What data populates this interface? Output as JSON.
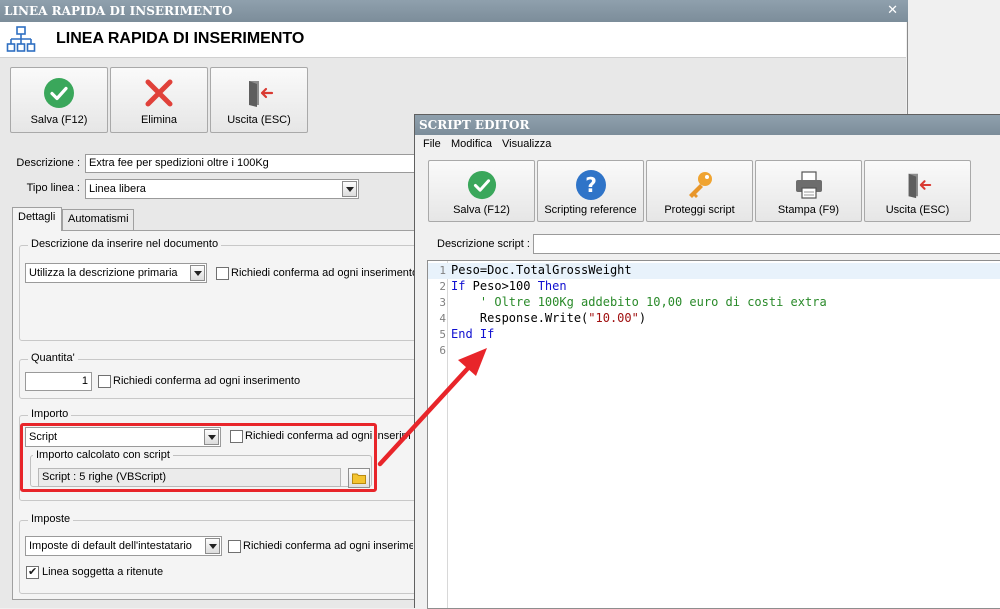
{
  "main_window": {
    "titlebar": "LINEA RAPIDA DI INSERIMENTO",
    "header_title": "LINEA RAPIDA DI INSERIMENTO",
    "toolbar": {
      "save_label": "Salva (F12)",
      "delete_label": "Elimina",
      "exit_label": "Uscita (ESC)"
    },
    "descrizione": {
      "label": "Descrizione :",
      "value": "Extra fee per spedizioni oltre i 100Kg"
    },
    "tipo_linea": {
      "label": "Tipo linea :",
      "value": "Linea libera"
    },
    "tabs": [
      {
        "label": "Dettagli"
      },
      {
        "label": "Automatismi"
      }
    ],
    "group_descrizione": {
      "title": "Descrizione da inserire nel documento",
      "select_value": "Utilizza la descrizione primaria",
      "confirm_label": "Richiedi conferma ad ogni inserimento"
    },
    "group_quantita": {
      "title": "Quantita'",
      "value": "1",
      "confirm_label": "Richiedi conferma ad ogni inserimento"
    },
    "group_importo": {
      "title": "Importo",
      "select_value": "Script",
      "confirm_label": "Richiedi conferma ad ogni inserimento",
      "sub_title": "Importo calcolato con script",
      "script_summary": "Script : 5 righe (VBScript)"
    },
    "group_imposte": {
      "title": "Imposte",
      "select_value": "Imposte di default dell'intestatario",
      "confirm_label": "Richiedi conferma ad ogni inserimento",
      "ritenute_label": "Linea soggetta a ritenute",
      "ritenute_checked": true
    }
  },
  "script_editor": {
    "titlebar": "SCRIPT EDITOR",
    "menu": [
      "File",
      "Modifica",
      "Visualizza"
    ],
    "toolbar": {
      "save_label": "Salva (F12)",
      "reference_label": "Scripting reference",
      "protect_label": "Proteggi script",
      "print_label": "Stampa (F9)",
      "exit_label": "Uscita (ESC)"
    },
    "descrizione_label": "Descrizione script :",
    "descrizione_value": "",
    "code_lines": [
      {
        "num": "1",
        "text": "Peso=Doc.TotalGrossWeight"
      },
      {
        "num": "2",
        "kw1": "If",
        "mid": " Peso>100 ",
        "kw2": "Then"
      },
      {
        "num": "3",
        "text": "    ' Oltre 100Kg addebito 10,00 euro di costi extra"
      },
      {
        "num": "4",
        "pre": "    Response.Write(",
        "str": "\"10.00\"",
        "post": ")"
      },
      {
        "num": "5",
        "text": "End If"
      },
      {
        "num": "6",
        "text": ""
      }
    ]
  },
  "colors": {
    "titlebar": "#8497a4",
    "highlight": "#e8252a",
    "keyword": "#1010d0",
    "comment": "#2a8a2a"
  }
}
